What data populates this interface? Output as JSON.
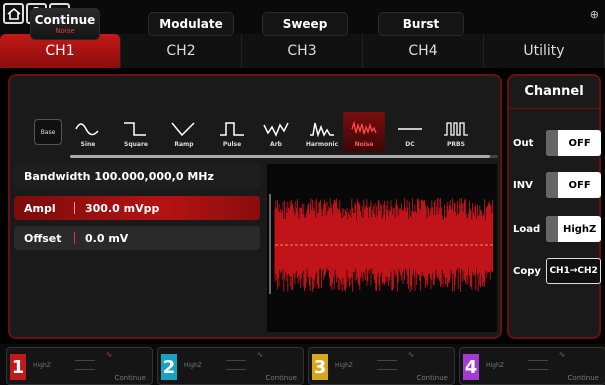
{
  "topbar": {
    "home_icon": "home-icon",
    "help_label": "?",
    "counter_label": "CNT",
    "usb_icon": "usb-icon"
  },
  "tabs": [
    {
      "label": "CH1",
      "active": true
    },
    {
      "label": "CH2",
      "active": false
    },
    {
      "label": "CH3",
      "active": false
    },
    {
      "label": "CH4",
      "active": false
    },
    {
      "label": "Utility",
      "active": false
    }
  ],
  "modes": {
    "continue_label": "Continue",
    "continue_sub": "Noise",
    "modulate_label": "Modulate",
    "sweep_label": "Sweep",
    "burst_label": "Burst"
  },
  "waveforms": {
    "base_label": "Base",
    "items": [
      {
        "label": "Sine",
        "icon": "sine-wave-icon"
      },
      {
        "label": "Square",
        "icon": "square-wave-icon"
      },
      {
        "label": "Ramp",
        "icon": "ramp-wave-icon"
      },
      {
        "label": "Pulse",
        "icon": "pulse-wave-icon"
      },
      {
        "label": "Arb",
        "icon": "arb-wave-icon"
      },
      {
        "label": "Harmonic",
        "icon": "harmonic-wave-icon"
      },
      {
        "label": "Noise",
        "icon": "noise-wave-icon",
        "active": true
      },
      {
        "label": "DC",
        "icon": "dc-wave-icon"
      },
      {
        "label": "PRBS",
        "icon": "prbs-wave-icon"
      }
    ]
  },
  "params": {
    "bandwidth_label": "Bandwidth",
    "bandwidth_value": "100.000,000,0 MHz",
    "ampl_label": "Ampl",
    "ampl_value": "300.0 mVpp",
    "offset_label": "Offset",
    "offset_value": "0.0 mV"
  },
  "channel_panel": {
    "title": "Channel",
    "out_label": "Out",
    "out_value": "OFF",
    "inv_label": "INV",
    "inv_value": "OFF",
    "load_label": "Load",
    "load_value": "HighZ",
    "copy_label": "Copy",
    "copy_value": "CH1→CH2"
  },
  "bottom": [
    {
      "num": "1",
      "load": "HighZ",
      "mode": "Continue",
      "color": "#c21a1a",
      "wave": "∿"
    },
    {
      "num": "2",
      "load": "HighZ",
      "mode": "Continue",
      "color": "#1aa0c2",
      "wave": "∿"
    },
    {
      "num": "3",
      "load": "HighZ",
      "mode": "Continue",
      "color": "#d9a51a",
      "wave": "∿"
    },
    {
      "num": "4",
      "load": "HighZ",
      "mode": "Continue",
      "color": "#a43ad1",
      "wave": "∿"
    }
  ],
  "colors": {
    "accent": "#c31818",
    "panel_border": "#6b0e0e"
  }
}
